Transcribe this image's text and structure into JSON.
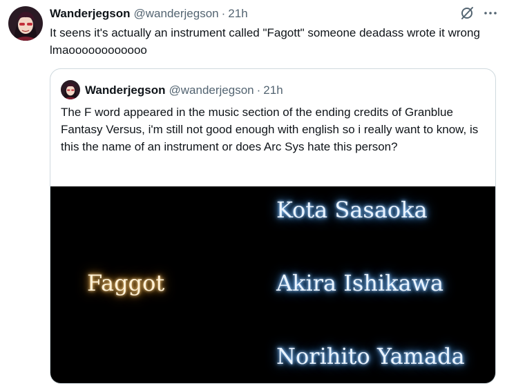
{
  "tweet": {
    "author_name": "Wanderjegson",
    "author_handle": "@wanderjegson",
    "separator": "·",
    "time": "21h",
    "text": "It seens it's actually an instrument called \"Fagott\" someone deadass wrote it wrong lmaoooooooooooo",
    "icons": [
      "grok-icon",
      "more-icon"
    ]
  },
  "quoted_tweet": {
    "author_name": "Wanderjegson",
    "author_handle": "@wanderjegson",
    "separator": "·",
    "time": "21h",
    "text": "The F word appeared in the music section of the ending credits of Granblue Fantasy Versus, i'm still not good enough with english so i really want to know, is this the name of an instrument or does Arc Sys hate this person?",
    "image": {
      "left_credit": "Faggot",
      "right_credits": [
        "Kota Sasaoka",
        "Akira Ishikawa",
        "Norihito Yamada"
      ]
    }
  },
  "colors": {
    "text": "#0f1419",
    "secondary": "#536471",
    "border": "#cfd9de",
    "glow_blue": "#5fb0ff",
    "glow_gold": "#e6a640"
  }
}
